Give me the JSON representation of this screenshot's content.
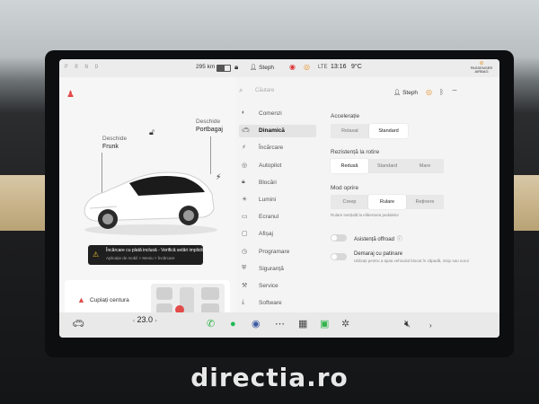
{
  "status_bar": {
    "gears": "P R N D",
    "range": "295 km",
    "user": "Steph",
    "clock": "13:16",
    "temperature": "9°C",
    "passenger_airbag": "PASSENGER AIRBAG"
  },
  "car_panel": {
    "frunk_action": "Deschide",
    "frunk_label": "Frunk",
    "trunk_action": "Deschide",
    "trunk_label": "Portbagaj",
    "toast_title": "Încărcare cu plată inclusă - Verifică setări implicite",
    "toast_subtitle": "Aplicație de mobil > Meniu > Încărcare",
    "seat_alert": "Cuplați centura"
  },
  "nav": {
    "search_placeholder": "Căutare",
    "items": [
      {
        "label": "Comenzi",
        "icon": "toggle-icon"
      },
      {
        "label": "Dinamică",
        "icon": "car-icon"
      },
      {
        "label": "Încărcare",
        "icon": "bolt-icon"
      },
      {
        "label": "Autopilot",
        "icon": "steering-icon"
      },
      {
        "label": "Blocări",
        "icon": "lock-icon"
      },
      {
        "label": "Lumini",
        "icon": "bulb-icon"
      },
      {
        "label": "Ecranul",
        "icon": "display-icon"
      },
      {
        "label": "Afișaj",
        "icon": "monitor-icon"
      },
      {
        "label": "Programare",
        "icon": "clock-icon"
      },
      {
        "label": "Siguranță",
        "icon": "shield-icon"
      },
      {
        "label": "Service",
        "icon": "wrench-icon"
      },
      {
        "label": "Software",
        "icon": "download-icon"
      }
    ],
    "active_index": 1
  },
  "detail": {
    "user": "Steph",
    "acceleration": {
      "title": "Accelerație",
      "options": [
        "Relaxat",
        "Standard"
      ],
      "selected": 1
    },
    "rolling_resistance": {
      "title": "Rezistență la rotire",
      "options": [
        "Redusă",
        "Standard",
        "Mare"
      ],
      "selected": 0
    },
    "stopping_mode": {
      "title": "Mod oprire",
      "options": [
        "Creep",
        "Rulare",
        "Reținere"
      ],
      "selected": 1
    },
    "stopping_hint": "Rulare inerțială la eliberarea pedalelor",
    "offroad": {
      "label": "Asistență offroad",
      "info": "ⓘ"
    },
    "slip_start": {
      "label": "Demaraj cu patinare",
      "desc": "Utilizați pentru a ajuta vehiculul blocat în zăpadă, nisip sau noroi"
    }
  },
  "dock": {
    "temperature": "23.0"
  },
  "watermark": "directia.ro",
  "colors": {
    "alert_red": "#e24a4a",
    "warning_yellow": "#f2c029",
    "phone_green": "#2fb34a"
  }
}
